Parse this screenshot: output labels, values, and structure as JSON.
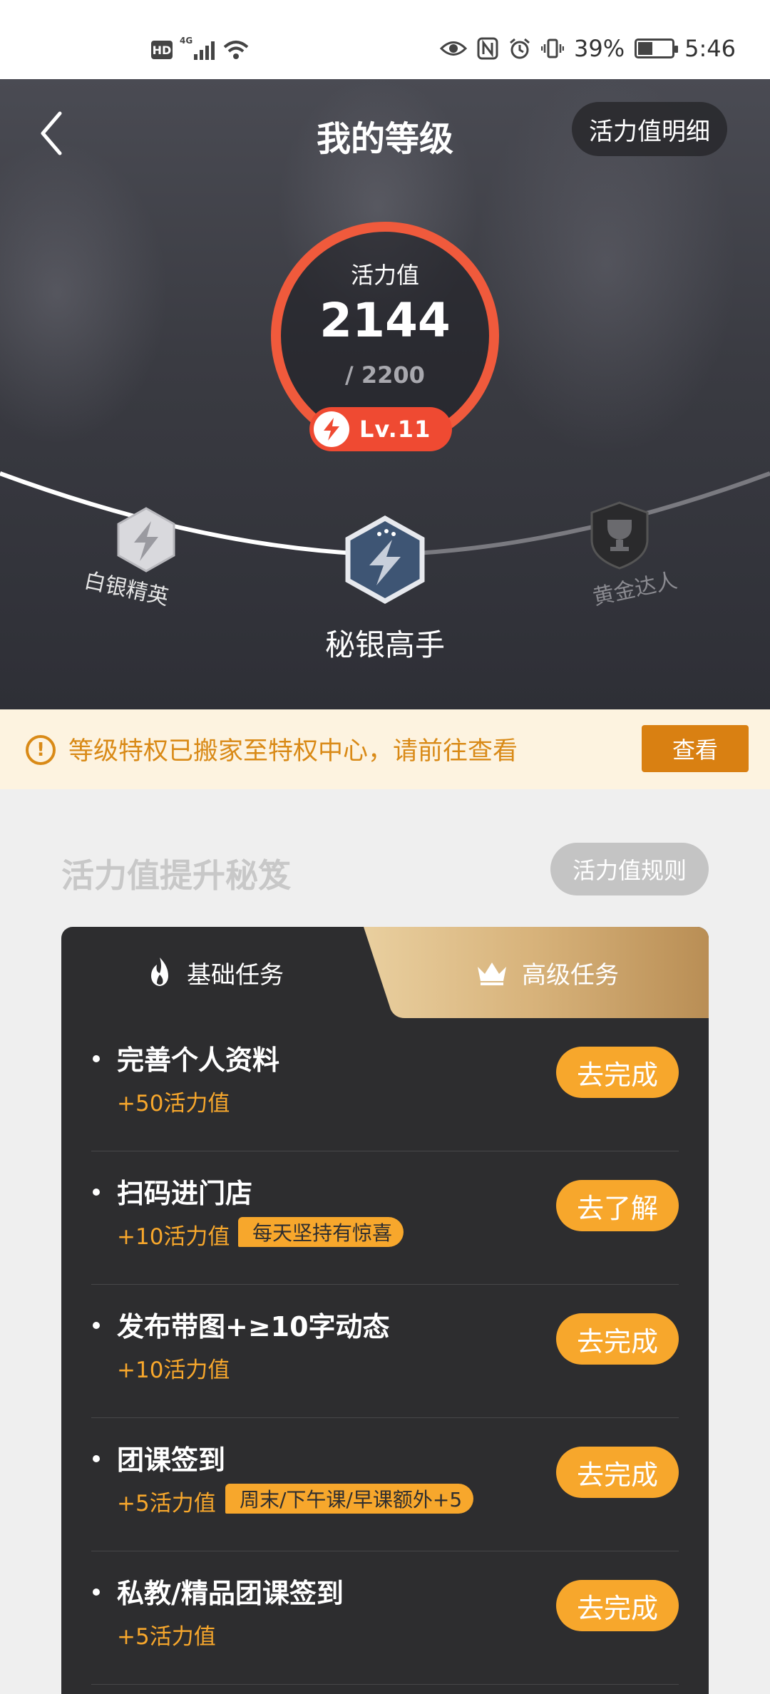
{
  "status_bar": {
    "hd": "HD",
    "network": "4G",
    "battery": "39%",
    "battery_level": 0.39,
    "time": "5:46"
  },
  "header": {
    "title": "我的等级",
    "detail_button": "活力值明细"
  },
  "vitality": {
    "label": "活力值",
    "value": "2144",
    "max": "/ 2200",
    "level": "Lv.11"
  },
  "levels": [
    {
      "name": "白银精英",
      "state": "passed"
    },
    {
      "name": "秘银高手",
      "state": "current"
    },
    {
      "name": "黄金达人",
      "state": "locked"
    }
  ],
  "notice": {
    "text": "等级特权已搬家至特权中心，请前往查看",
    "button": "查看"
  },
  "section": {
    "title": "活力值提升秘笈",
    "rules_button": "活力值规则"
  },
  "tabs": [
    {
      "label": "基础任务",
      "icon": "flame-icon",
      "active": true
    },
    {
      "label": "高级任务",
      "icon": "crown-icon",
      "active": false
    }
  ],
  "tasks": [
    {
      "title": "完善个人资料",
      "reward": "+50活力值",
      "tag": "",
      "button": "去完成"
    },
    {
      "title": "扫码进门店",
      "reward": "+10活力值",
      "tag": "每天坚持有惊喜",
      "button": "去了解"
    },
    {
      "title": "发布带图+≥10字动态",
      "reward": "+10活力值",
      "tag": "",
      "button": "去完成"
    },
    {
      "title": "团课签到",
      "reward": "+5活力值",
      "tag": "周末/下午课/早课额外+5",
      "button": "去完成"
    },
    {
      "title": "私教/精品团课签到",
      "reward": "+5活力值",
      "tag": "",
      "button": "去完成"
    }
  ],
  "colors": {
    "accent": "#f7a72c",
    "ring": "#f05a3c",
    "notice_text": "#d98a17",
    "panel_bg": "#2d2d2f"
  }
}
